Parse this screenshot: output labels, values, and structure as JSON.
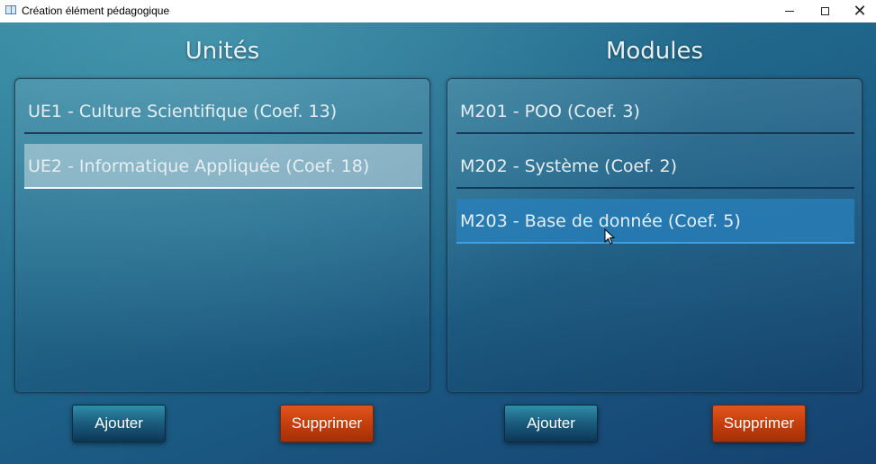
{
  "window": {
    "title": "Création élément pédagogique",
    "minimize_glyph": "",
    "maximize_glyph": "",
    "close_glyph": "✕"
  },
  "units": {
    "heading": "Unités",
    "items": [
      {
        "label": "UE1 - Culture Scientifique (Coef. 13)",
        "state": "normal"
      },
      {
        "label": "UE2 - Informatique Appliquée (Coef. 18)",
        "state": "selected"
      }
    ],
    "add_label": "Ajouter",
    "delete_label": "Supprimer"
  },
  "modules": {
    "heading": "Modules",
    "items": [
      {
        "label": "M201 - POO (Coef. 3)",
        "state": "normal"
      },
      {
        "label": "M202 - Système (Coef. 2)",
        "state": "normal"
      },
      {
        "label": "M203 - Base de donnée (Coef. 5)",
        "state": "hovered"
      }
    ],
    "add_label": "Ajouter",
    "delete_label": "Supprimer"
  },
  "colors": {
    "add_button": "#1b5f80",
    "delete_button": "#c43f0d",
    "selected_item": "#ffffff",
    "hover_item": "#2882be"
  }
}
